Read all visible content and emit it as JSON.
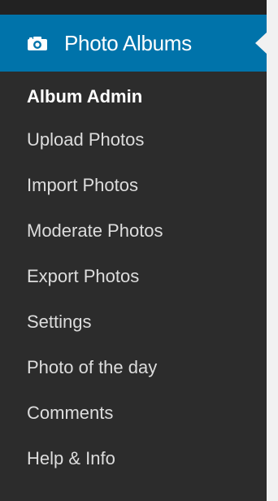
{
  "menu": {
    "title": "Photo Albums",
    "icon": "camera-icon",
    "accent_color": "#0073aa"
  },
  "submenu": {
    "items": [
      {
        "label": "Album Admin",
        "current": true
      },
      {
        "label": "Upload Photos"
      },
      {
        "label": "Import Photos"
      },
      {
        "label": "Moderate Photos"
      },
      {
        "label": "Export Photos"
      },
      {
        "label": "Settings"
      },
      {
        "label": "Photo of the day"
      },
      {
        "label": "Comments"
      },
      {
        "label": "Help & Info"
      }
    ]
  }
}
